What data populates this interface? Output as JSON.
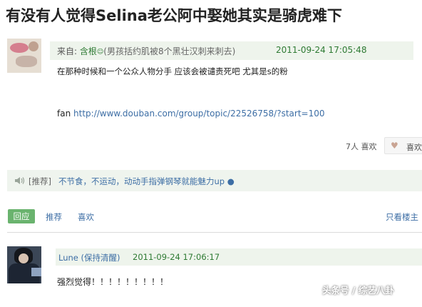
{
  "title": "有没有人觉得Selina老公阿中娶她其实是骑虎难下",
  "post": {
    "from_label": "来自:",
    "author": "含根",
    "author_face": "☺",
    "author_signature": "(男孩括约肌被8个黑壮汉刺来刺去)",
    "time": "2011-09-24 17:05:48",
    "body": "在那种时候和一个公众人物分手 应该会被谴责死吧 尤其是s的粉",
    "fan_label": "fan",
    "fan_url": "http://www.douban.com/group/topic/22526758/?start=100",
    "likes_count_text": "7人 喜欢",
    "like_button_label": "喜欢"
  },
  "recommend": {
    "tag": "[推荐]",
    "message": "不节食，不运动，动动手指弹钢琴就能魅力up ●"
  },
  "actions": {
    "reply_label": "回应",
    "recommend_label": "推荐",
    "like_label": "喜欢",
    "only_op_label": "只看楼主"
  },
  "reply": {
    "name": "Lune (保持清醒)",
    "time": "2011-09-24 17:06:17",
    "text": "强烈觉得！！！！！！！！！"
  },
  "watermark": "头条号 / 综艺八卦",
  "colors": {
    "green_text": "#2e7a33",
    "link_blue": "#3d6ea5",
    "reply_button": "#6ab36e",
    "bar_bg": "#eef4ec"
  }
}
